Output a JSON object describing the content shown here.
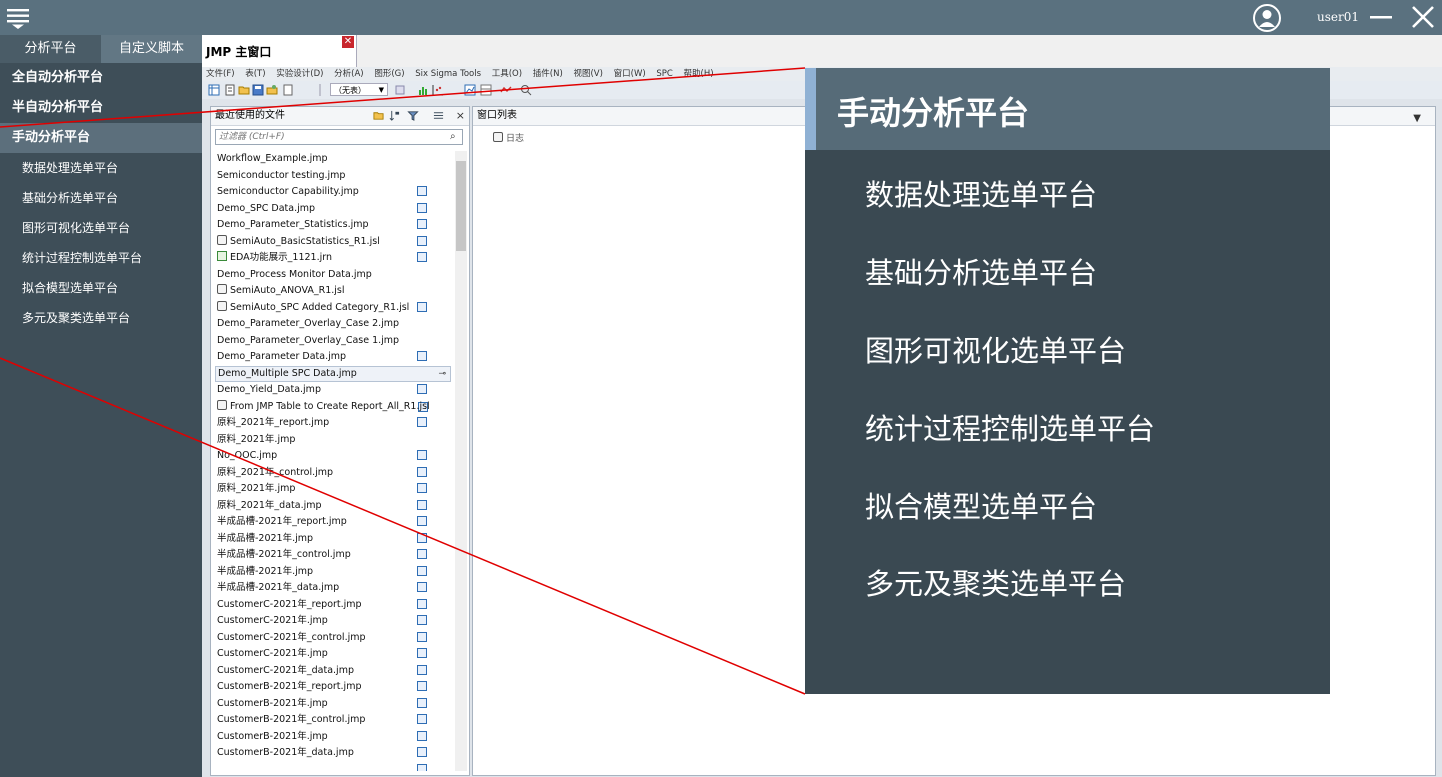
{
  "topbar": {
    "username": "user01"
  },
  "sidebar": {
    "tabs": [
      {
        "label": "分析平台"
      },
      {
        "label": "自定义脚本"
      }
    ],
    "platforms": [
      {
        "label": "全自动分析平台"
      },
      {
        "label": "半自动分析平台"
      },
      {
        "label": "手动分析平台"
      }
    ],
    "submenu": [
      {
        "label": "数据处理选单平台"
      },
      {
        "label": "基础分析选单平台"
      },
      {
        "label": "图形可视化选单平台"
      },
      {
        "label": "统计过程控制选单平台"
      },
      {
        "label": "拟合模型选单平台"
      },
      {
        "label": "多元及聚类选单平台"
      }
    ]
  },
  "jmp": {
    "tab_title": "JMP 主窗口",
    "menu": [
      "文件(F)",
      "表(T)",
      "实验设计(D)",
      "分析(A)",
      "图形(G)",
      "Six Sigma Tools",
      "工具(O)",
      "插件(N)",
      "视图(V)",
      "窗口(W)",
      "SPC",
      "帮助(H)"
    ],
    "toolbar_select": "（无表）",
    "recent": {
      "title": "最近使用的文件",
      "filter_placeholder": "过滤器 (Ctrl+F)",
      "files": [
        {
          "name": "Workflow_Example.jmp",
          "type": "jmp"
        },
        {
          "name": "Semiconductor testing.jmp",
          "type": "jmp"
        },
        {
          "name": "Semiconductor Capability.jmp",
          "type": "jmp"
        },
        {
          "name": "Demo_SPC Data.jmp",
          "type": "jmp"
        },
        {
          "name": "Demo_Parameter_Statistics.jmp",
          "type": "jmp"
        },
        {
          "name": "SemiAuto_BasicStatistics_R1.jsl",
          "type": "jsl"
        },
        {
          "name": "EDA功能展示_1121.jrn",
          "type": "jrn"
        },
        {
          "name": "Demo_Process Monitor Data.jmp",
          "type": "jmp"
        },
        {
          "name": "SemiAuto_ANOVA_R1.jsl",
          "type": "jsl"
        },
        {
          "name": "SemiAuto_SPC Added Category_R1.jsl",
          "type": "jsl"
        },
        {
          "name": "Demo_Parameter_Overlay_Case 2.jmp",
          "type": "jmp"
        },
        {
          "name": "Demo_Parameter_Overlay_Case 1.jmp",
          "type": "jmp"
        },
        {
          "name": "Demo_Parameter Data.jmp",
          "type": "jmp"
        },
        {
          "name": "Demo_Multiple SPC Data.jmp",
          "type": "jmp"
        },
        {
          "name": "Demo_Yield_Data.jmp",
          "type": "jmp"
        },
        {
          "name": "From JMP Table to Create Report_All_R1.jsl",
          "type": "jsl"
        },
        {
          "name": "原料_2021年_report.jmp",
          "type": "jmp"
        },
        {
          "name": "原料_2021年.jmp",
          "type": "jmp"
        },
        {
          "name": "No_OOC.jmp",
          "type": "jmp"
        },
        {
          "name": "原料_2021年_control.jmp",
          "type": "jmp"
        },
        {
          "name": "原料_2021年.jmp",
          "type": "jmp"
        },
        {
          "name": "原料_2021年_data.jmp",
          "type": "jmp"
        },
        {
          "name": "半成品槽-2021年_report.jmp",
          "type": "jmp"
        },
        {
          "name": "半成品槽-2021年.jmp",
          "type": "jmp"
        },
        {
          "name": "半成品槽-2021年_control.jmp",
          "type": "jmp"
        },
        {
          "name": "半成品槽-2021年.jmp",
          "type": "jmp"
        },
        {
          "name": "半成品槽-2021年_data.jmp",
          "type": "jmp"
        },
        {
          "name": "CustomerC-2021年_report.jmp",
          "type": "jmp"
        },
        {
          "name": "CustomerC-2021年.jmp",
          "type": "jmp"
        },
        {
          "name": "CustomerC-2021年_control.jmp",
          "type": "jmp"
        },
        {
          "name": "CustomerC-2021年.jmp",
          "type": "jmp"
        },
        {
          "name": "CustomerC-2021年_data.jmp",
          "type": "jmp"
        },
        {
          "name": "CustomerB-2021年_report.jmp",
          "type": "jmp"
        },
        {
          "name": "CustomerB-2021年.jmp",
          "type": "jmp"
        },
        {
          "name": "CustomerB-2021年_control.jmp",
          "type": "jmp"
        },
        {
          "name": "CustomerB-2021年.jmp",
          "type": "jmp"
        },
        {
          "name": "CustomerB-2021年_data.jmp",
          "type": "jmp"
        }
      ]
    },
    "window_list": {
      "title": "窗口列表",
      "entries": [
        {
          "label": "日志"
        }
      ]
    }
  },
  "callout": {
    "title": "手动分析平台",
    "items": [
      "数据处理选单平台",
      "基础分析选单平台",
      "图形可视化选单平台",
      "统计过程控制选单平台",
      "拟合模型选单平台",
      "多元及聚类选单平台"
    ]
  },
  "colors": {
    "topbar": "#5a717f",
    "sidebar": "#3e4e58",
    "callout_bg": "#3a4952",
    "callout_accent": "#8fb1d4",
    "zoom_line": "#e00000"
  }
}
